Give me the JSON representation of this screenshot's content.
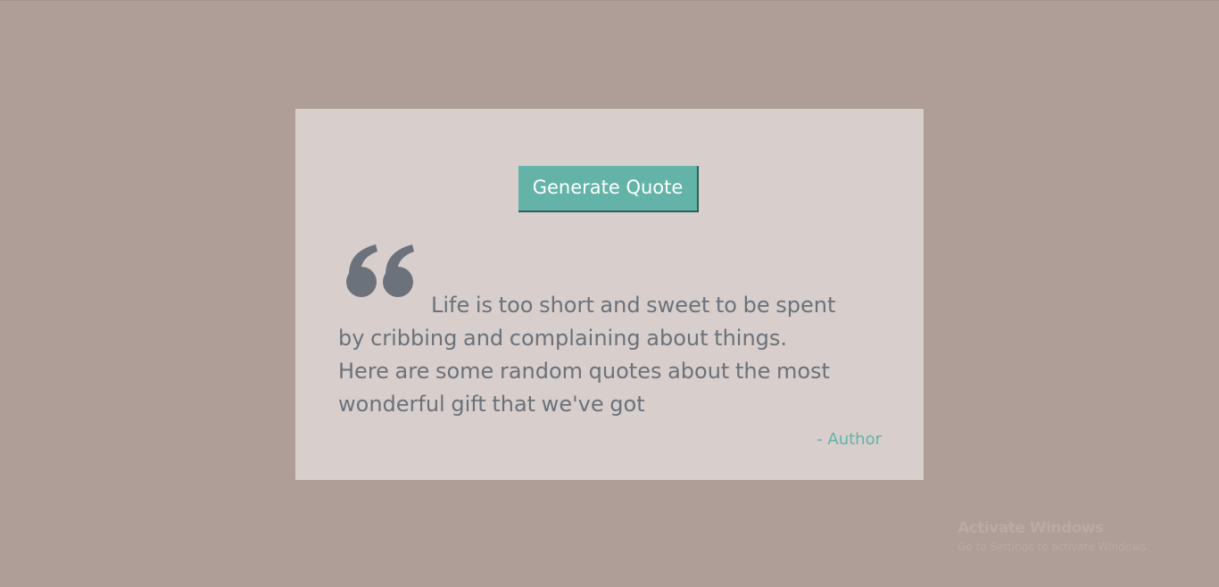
{
  "theme": {
    "page_background": "#ae9e97",
    "card_background": "#d8cecb",
    "accent": "#63b3a8",
    "text_color": "#6b727b"
  },
  "quote_box": {
    "button_label": "Generate Quote",
    "quote_icon": "quote-left-icon",
    "lines": [
      "Life is too short and sweet to be spent",
      "by cribbing and complaining about things.",
      "Here are some random quotes about the most",
      "wonderful gift that we've got"
    ],
    "author": "- Author"
  },
  "os_watermark": {
    "title": "Activate Windows",
    "subtitle": "Go to Settings to activate Windows."
  }
}
